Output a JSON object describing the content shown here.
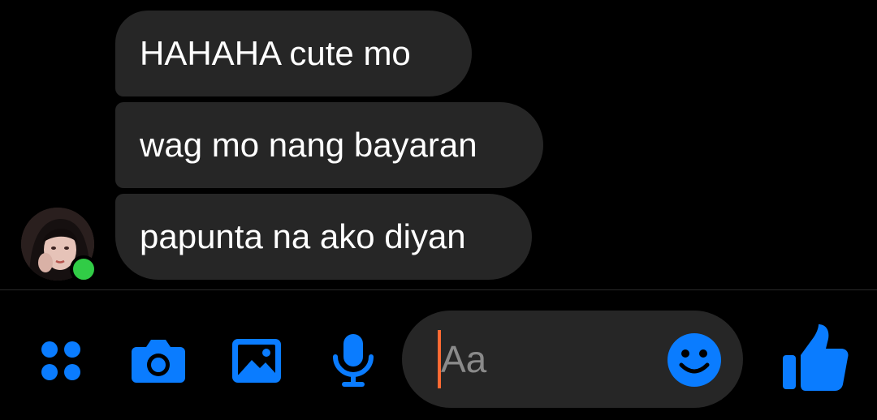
{
  "colors": {
    "background": "#000000",
    "bubble": "#262626",
    "accent": "#0a7cff",
    "presence": "#31cc46",
    "caret": "#ff6a33"
  },
  "messages": [
    {
      "text": "HAHAHA cute mo"
    },
    {
      "text": "wag mo nang bayaran"
    },
    {
      "text": "papunta na ako diyan"
    }
  ],
  "sender": {
    "online": true
  },
  "composer": {
    "placeholder": "Aa",
    "value": ""
  },
  "toolbar": {
    "icons": [
      "apps-icon",
      "camera-icon",
      "photo-icon",
      "microphone-icon",
      "emoji-icon",
      "thumbs-up-icon"
    ]
  }
}
